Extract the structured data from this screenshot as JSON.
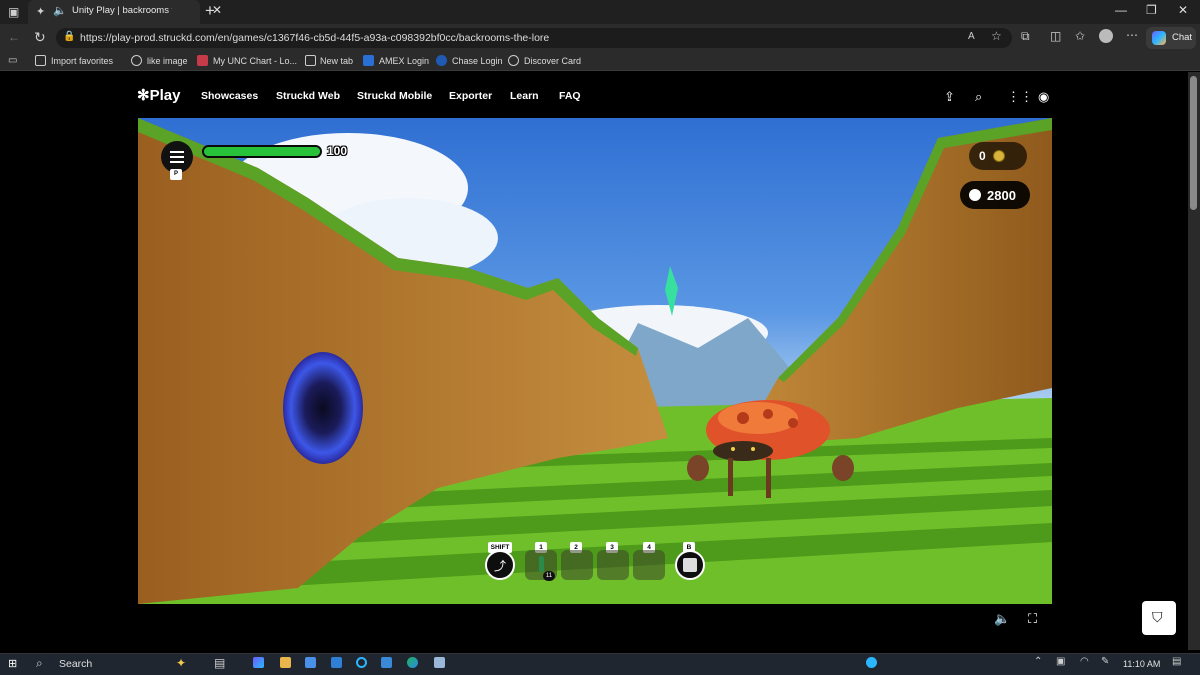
{
  "browser": {
    "tab_title": "Unity Play | backrooms the lo",
    "url": "https://play-prod.struckd.com/en/games/c1367f46-cb5d-44f5-a93a-c098392bf0cc/backrooms-the-lore",
    "chat_label": "Chat",
    "bookmarks": [
      {
        "label": "Import favorites"
      },
      {
        "label": "like image"
      },
      {
        "label": "My UNC Chart - Lo..."
      },
      {
        "label": "New tab"
      },
      {
        "label": "AMEX Login"
      },
      {
        "label": "Chase Login"
      },
      {
        "label": "Discover Card"
      }
    ]
  },
  "site": {
    "logo": "Play",
    "nav": [
      "Showcases",
      "Struckd Web",
      "Struckd Mobile",
      "Exporter",
      "Learn",
      "FAQ"
    ]
  },
  "hud": {
    "menu_key": "P",
    "health": 100,
    "health_max": 100,
    "health_label": "100",
    "coins": "0",
    "score": "2800",
    "sprint_key": "SHIFT",
    "slots": [
      {
        "key": "1",
        "count": "11"
      },
      {
        "key": "2",
        "count": ""
      },
      {
        "key": "3",
        "count": ""
      },
      {
        "key": "4",
        "count": ""
      }
    ],
    "action_key": "B"
  },
  "taskbar": {
    "search_label": "Search",
    "time": "11:10 AM"
  },
  "colors": {
    "health": "#27c13a",
    "coin": "#d9b33a",
    "sky": "#2f6fd2",
    "grass": "#6fbf2a",
    "cliff": "#b07a2e"
  }
}
